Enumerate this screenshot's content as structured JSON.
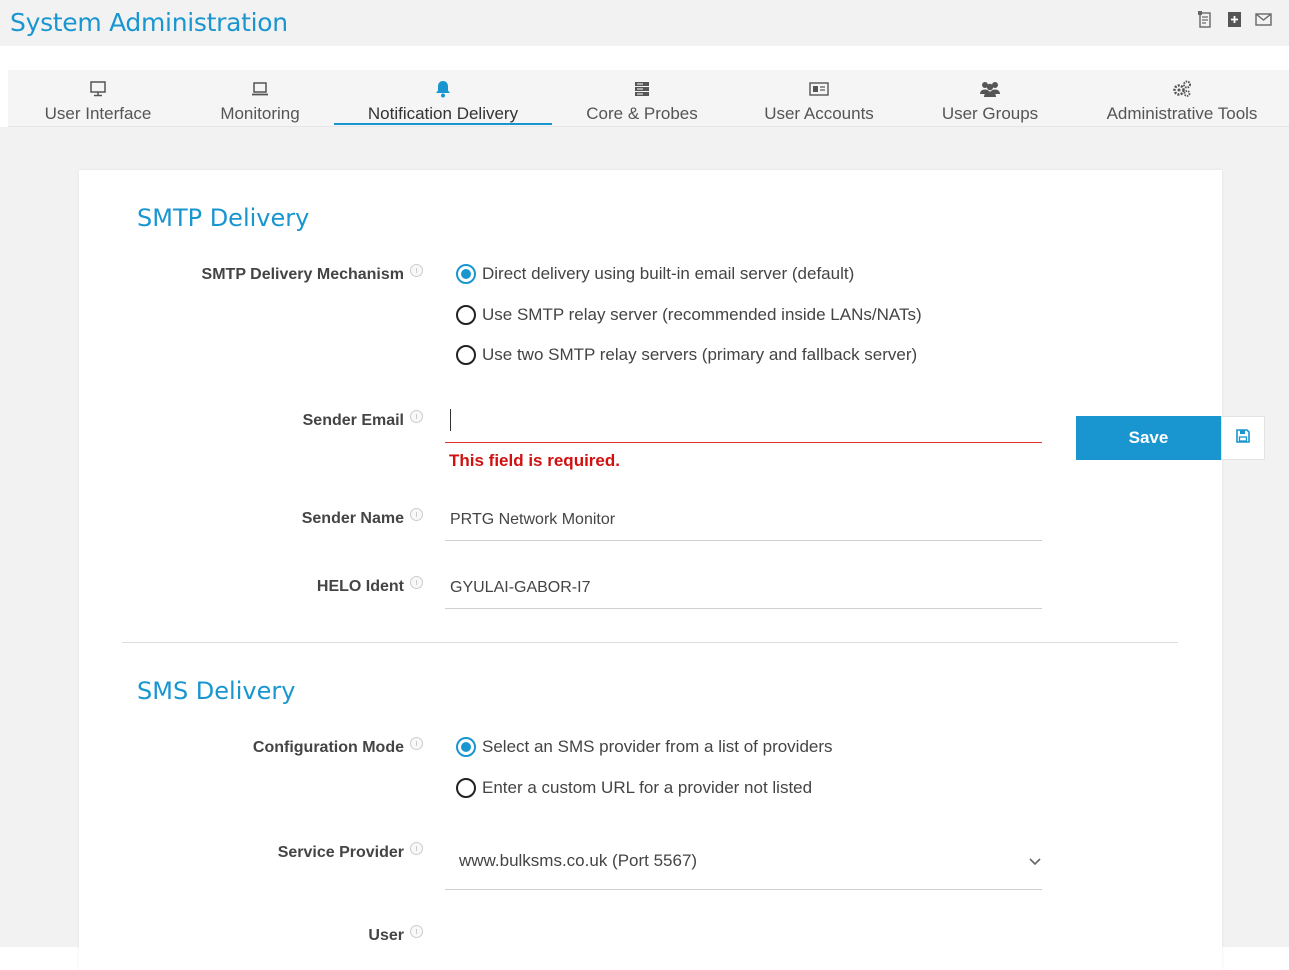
{
  "header": {
    "title": "System Administration",
    "icons": [
      "notes-icon",
      "export-icon",
      "mail-icon"
    ]
  },
  "tabs": [
    {
      "label": "User Interface",
      "icon": "monitor-icon",
      "active": false
    },
    {
      "label": "Monitoring",
      "icon": "laptop-icon",
      "active": false
    },
    {
      "label": "Notification Delivery",
      "icon": "bell-icon",
      "active": true
    },
    {
      "label": "Core & Probes",
      "icon": "server-icon",
      "active": false
    },
    {
      "label": "User Accounts",
      "icon": "id-card-icon",
      "active": false
    },
    {
      "label": "User Groups",
      "icon": "users-icon",
      "active": false
    },
    {
      "label": "Administrative Tools",
      "icon": "gears-icon",
      "active": false
    }
  ],
  "smtp": {
    "title": "SMTP Delivery",
    "mechanism_label": "SMTP Delivery Mechanism",
    "options": [
      "Direct delivery using built-in email server (default)",
      "Use SMTP relay server (recommended inside LANs/NATs)",
      "Use two SMTP relay servers (primary and fallback server)"
    ],
    "selected_option": 0,
    "sender_email_label": "Sender Email",
    "sender_email_value": "",
    "sender_email_error": "This field is required.",
    "sender_name_label": "Sender Name",
    "sender_name_value": "PRTG Network Monitor",
    "helo_label": "HELO Ident",
    "helo_value": "GYULAI-GABOR-I7"
  },
  "sms": {
    "title": "SMS Delivery",
    "config_mode_label": "Configuration Mode",
    "options": [
      "Select an SMS provider from a list of providers",
      "Enter a custom URL for a provider not listed"
    ],
    "selected_option": 0,
    "service_provider_label": "Service Provider",
    "service_provider_value": "www.bulksms.co.uk (Port 5567)",
    "user_label": "User"
  },
  "actions": {
    "save_label": "Save"
  },
  "colors": {
    "accent": "#1996d0",
    "error": "#d11111"
  }
}
